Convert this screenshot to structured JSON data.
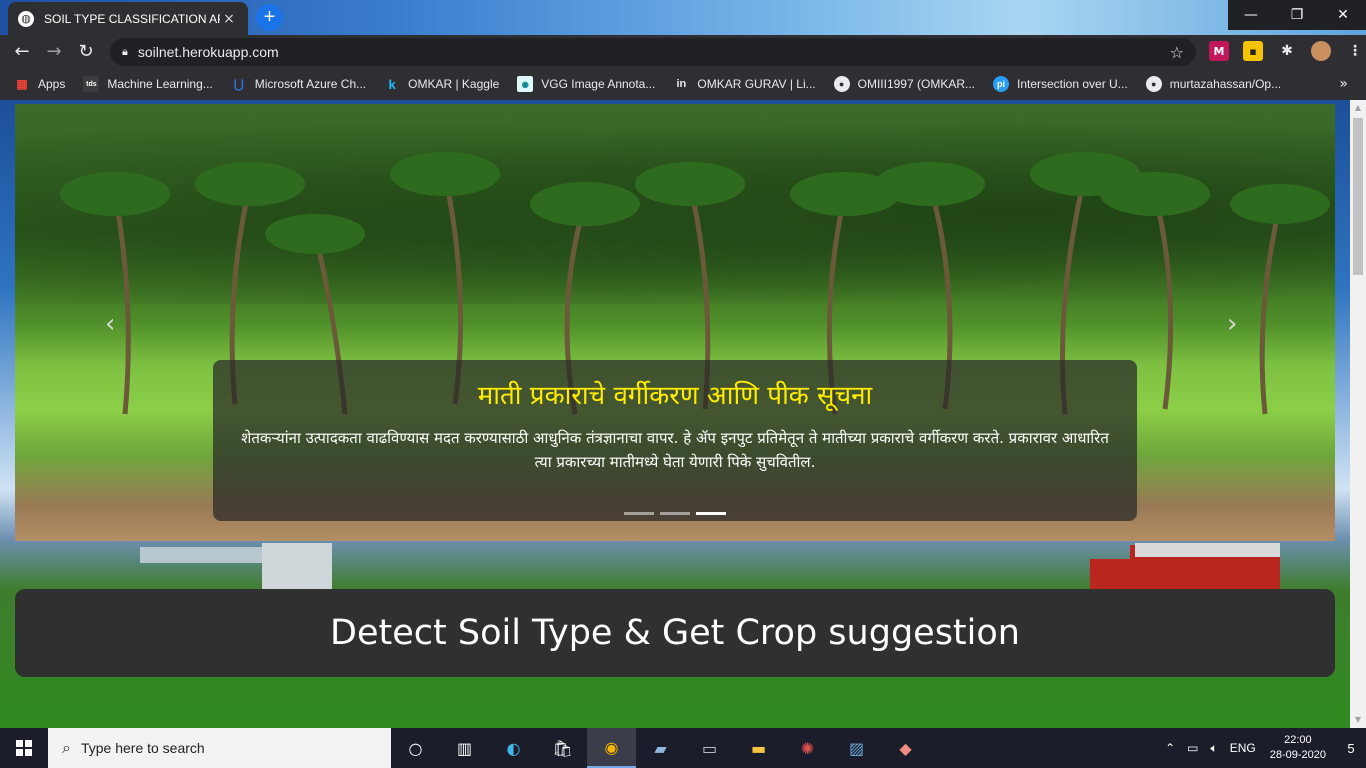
{
  "browser": {
    "tab": {
      "title": "SOIL TYPE CLASSIFICATION API",
      "close": "×"
    },
    "new_tab": "+",
    "window_controls": {
      "minimize": "—",
      "restore": "❐",
      "close": "✕"
    },
    "url": "soilnet.herokuapp.com",
    "bookmarks": [
      {
        "label": "Apps",
        "icon": "apps-grid-icon",
        "color": "#ea4335"
      },
      {
        "label": "Machine Learning...",
        "icon": "tds-icon",
        "color": "#3c3c3c"
      },
      {
        "label": "Microsoft Azure Ch...",
        "icon": "azure-icon",
        "color": "#2e6fd8"
      },
      {
        "label": "OMKAR | Kaggle",
        "icon": "kaggle-icon",
        "color": "#20beff"
      },
      {
        "label": "VGG Image Annota...",
        "icon": "vgg-icon",
        "color": "#26c6da"
      },
      {
        "label": "OMKAR GURAV | Li...",
        "icon": "linkedin-icon",
        "color": "#0a66c2"
      },
      {
        "label": "OMIII1997 (OMKAR...",
        "icon": "github-icon",
        "color": "#e8eaed"
      },
      {
        "label": "Intersection over U...",
        "icon": "pyimagesearch-icon",
        "color": "#2a9df4"
      },
      {
        "label": "murtazahassan/Op...",
        "icon": "github-icon",
        "color": "#e8eaed"
      }
    ],
    "bookmarks_more": "»"
  },
  "page": {
    "carousel": {
      "title": "माती प्रकाराचे वर्गीकरण आणि पीक सूचना",
      "text": "शेतकऱ्यांना उत्पादकता वाढविण्यास मदत करण्यासाठी आधुनिक तंत्रज्ञानाचा वापर. हे ॲप इनपुट प्रतिमेतून ते मातीच्या प्रकाराचे वर्गीकरण करते. प्रकारावर आधारित त्या प्रकारच्या मातीमध्ये घेता येणारी पिके सुचवितील.",
      "prev": "‹",
      "next": "›",
      "slides": 3,
      "active_slide": 3
    },
    "heading": "Detect Soil Type & Get Crop suggestion"
  },
  "taskbar": {
    "search_placeholder": "Type here to search",
    "apps": [
      "cortana-icon",
      "task-view-icon",
      "edge-icon",
      "store-icon",
      "chrome-icon",
      "anaconda-icon",
      "terminal-icon",
      "file-explorer-icon",
      "network-icon",
      "photos-icon",
      "paint-icon"
    ],
    "language": "ENG",
    "time": "22:00",
    "date": "28-09-2020",
    "notifications": "5"
  },
  "colors": {
    "caption_title": "#ffec00",
    "accent": "#1a73e8",
    "banner_bg": "#303030"
  }
}
